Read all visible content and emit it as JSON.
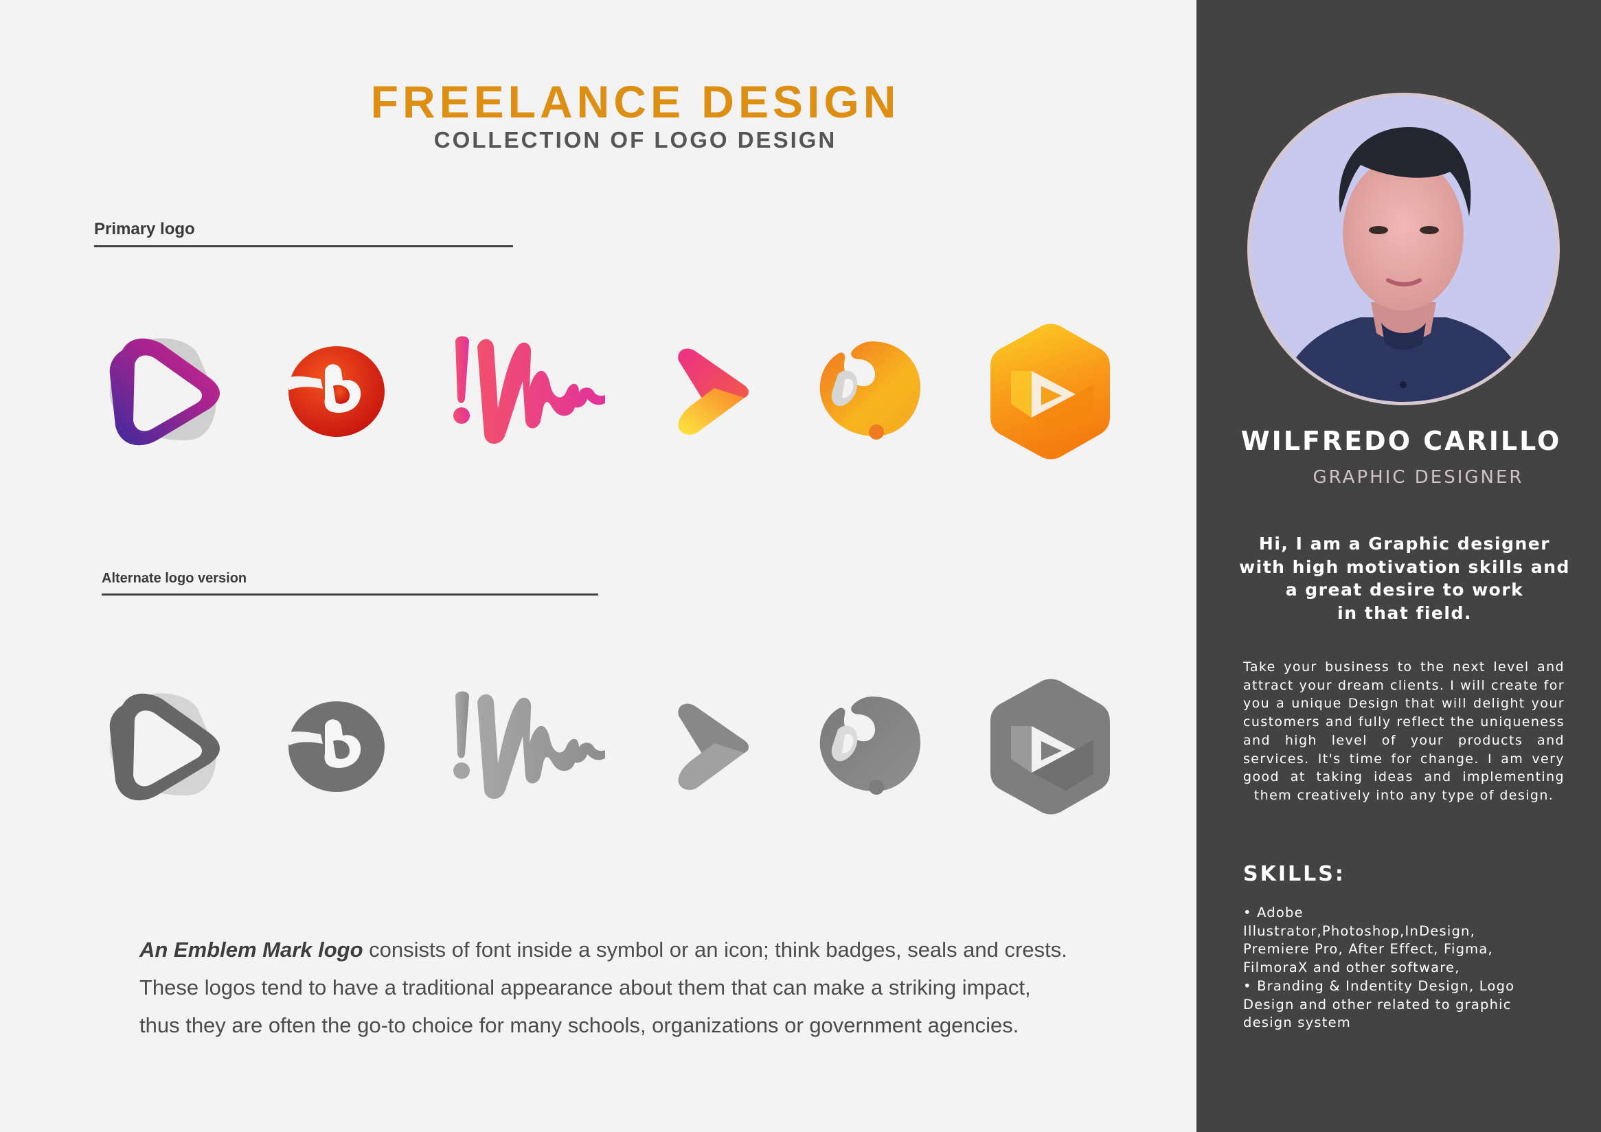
{
  "header": {
    "title": "FREELANCE DESIGN",
    "subtitle": "COLLECTION OF LOGO DESIGN"
  },
  "sections": {
    "primary_label": "Primary logo",
    "alternate_label": "Alternate logo version"
  },
  "description": {
    "emphasis": "An Emblem Mark logo",
    "line1_rest": " consists of font inside a symbol or an icon; think badges, seals and crests.",
    "line2": "These logos tend to have a traditional appearance about them that can make a striking impact,",
    "line3": "thus they are often the go-to choice for many schools, organizations or government agencies."
  },
  "profile": {
    "name": "WILFREDO CARILLO",
    "role": "GRAPHIC DESIGNER",
    "intro_lines": [
      "Hi, I am a Graphic designer",
      "with high motivation skills and",
      "a great desire to work",
      "in that field."
    ],
    "about": "Take your business to the next level and attract your dream clients. I will create for you a unique Design that will delight your customers and fully reflect the uniqueness and high level of your products and services. It's time for change. I am very good at taking ideas and implementing them creatively into any type of design.",
    "skills_title": "SKILLS:",
    "skills_lines": [
      "• Adobe",
      "Illustrator,Photoshop,InDesign,",
      "Premiere Pro, After Effect, Figma,",
      "FilmoraX and other software,",
      "• Branding & Indentity Design, Logo",
      "Design and other related to graphic",
      "design system"
    ]
  },
  "colors": {
    "accent": "#dc8f12",
    "sidebar_bg": "#434343",
    "page_bg": "#f3f3f3"
  },
  "icons": {
    "primary": [
      "play-triangle-logo",
      "letter-b-logo",
      "soundwave-logo",
      "play-arrow-logo",
      "swirl-circle-logo",
      "hexagon-play-logo"
    ],
    "alternate": [
      "play-triangle-logo-gray",
      "letter-b-logo-gray",
      "soundwave-logo-gray",
      "play-arrow-logo-gray",
      "swirl-circle-logo-gray",
      "hexagon-play-logo-gray"
    ]
  }
}
